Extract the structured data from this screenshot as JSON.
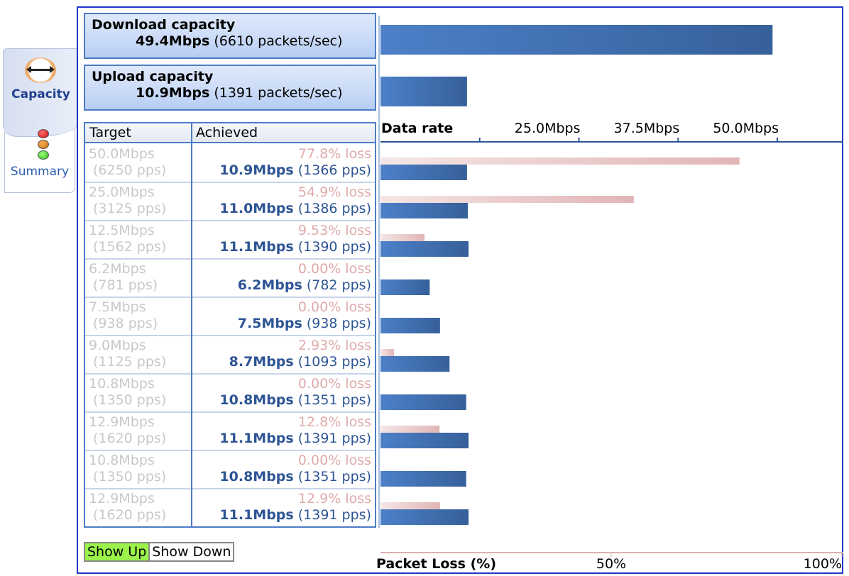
{
  "tabs": [
    {
      "label": "Capacity",
      "icon": "double-arrow-icon",
      "active": true
    },
    {
      "label": "Summary",
      "icon": "traffic-light-icon",
      "active": false
    }
  ],
  "download": {
    "title": "Download capacity",
    "rate": "49.4Mbps",
    "packets": "(6610 packets/sec)",
    "mbps": 49.4
  },
  "upload": {
    "title": "Upload capacity",
    "rate": "10.9Mbps",
    "packets": "(1391 packets/sec)",
    "mbps": 10.9
  },
  "table": {
    "headers": {
      "target": "Target",
      "achieved": "Achieved"
    },
    "rows": [
      {
        "target_rate": "50.0Mbps",
        "target_pps": "(6250 pps)",
        "loss": "77.8% loss",
        "achieved_rate": "10.9Mbps",
        "achieved_pps": "(1366 pps)"
      },
      {
        "target_rate": "25.0Mbps",
        "target_pps": "(3125 pps)",
        "loss": "54.9% loss",
        "achieved_rate": "11.0Mbps",
        "achieved_pps": "(1386 pps)"
      },
      {
        "target_rate": "12.5Mbps",
        "target_pps": "(1562 pps)",
        "loss": "9.53% loss",
        "achieved_rate": "11.1Mbps",
        "achieved_pps": "(1390 pps)"
      },
      {
        "target_rate": "6.2Mbps",
        "target_pps": "(781 pps)",
        "loss": "0.00% loss",
        "achieved_rate": "6.2Mbps",
        "achieved_pps": "(782 pps)"
      },
      {
        "target_rate": "7.5Mbps",
        "target_pps": "(938 pps)",
        "loss": "0.00% loss",
        "achieved_rate": "7.5Mbps",
        "achieved_pps": "(938 pps)"
      },
      {
        "target_rate": "9.0Mbps",
        "target_pps": "(1125 pps)",
        "loss": "2.93% loss",
        "achieved_rate": "8.7Mbps",
        "achieved_pps": "(1093 pps)"
      },
      {
        "target_rate": "10.8Mbps",
        "target_pps": "(1350 pps)",
        "loss": "0.00% loss",
        "achieved_rate": "10.8Mbps",
        "achieved_pps": "(1351 pps)"
      },
      {
        "target_rate": "12.9Mbps",
        "target_pps": "(1620 pps)",
        "loss": "12.8% loss",
        "achieved_rate": "11.1Mbps",
        "achieved_pps": "(1391 pps)"
      },
      {
        "target_rate": "10.8Mbps",
        "target_pps": "(1350 pps)",
        "loss": "0.00% loss",
        "achieved_rate": "10.8Mbps",
        "achieved_pps": "(1351 pps)"
      },
      {
        "target_rate": "12.9Mbps",
        "target_pps": "(1620 pps)",
        "loss": "12.9% loss",
        "achieved_rate": "11.1Mbps",
        "achieved_pps": "(1391 pps)"
      }
    ]
  },
  "buttons": {
    "show_up": "Show Up",
    "show_down": "Show Down",
    "active": "show_up"
  },
  "colors": {
    "rate_bar_start": "#4d80c8",
    "rate_bar_end": "#36609a",
    "loss_bar_start": "#f5e6e6",
    "loss_bar_end": "#e2b5b5",
    "frame": "#2233cc",
    "axis": "#2d5595",
    "active_button": "#9bf24a"
  },
  "chart_data": {
    "type": "bar",
    "orientation": "horizontal",
    "rate_axis": {
      "title": "Data rate",
      "unit": "Mbps",
      "range": [
        0,
        50
      ],
      "ticks": [
        12.5,
        25.0,
        37.5,
        50.0
      ],
      "tick_labels": [
        "",
        "25.0Mbps",
        "37.5Mbps",
        "50.0Mbps"
      ],
      "placement": "top"
    },
    "loss_axis": {
      "title": "Packet Loss (%)",
      "range": [
        0,
        100
      ],
      "ticks": [
        50,
        100
      ],
      "tick_labels": [
        "50%",
        "100%"
      ],
      "placement": "bottom"
    },
    "capacity": [
      {
        "name": "Download capacity",
        "mbps": 49.4
      },
      {
        "name": "Upload capacity",
        "mbps": 10.9
      }
    ],
    "series": [
      {
        "name": "Achieved rate (Mbps)",
        "values": [
          10.9,
          11.0,
          11.1,
          6.2,
          7.5,
          8.7,
          10.8,
          11.1,
          10.8,
          11.1
        ]
      },
      {
        "name": "Packet loss (%)",
        "values": [
          77.8,
          54.9,
          9.53,
          0.0,
          0.0,
          2.93,
          0.0,
          12.8,
          0.0,
          12.9
        ]
      }
    ]
  }
}
